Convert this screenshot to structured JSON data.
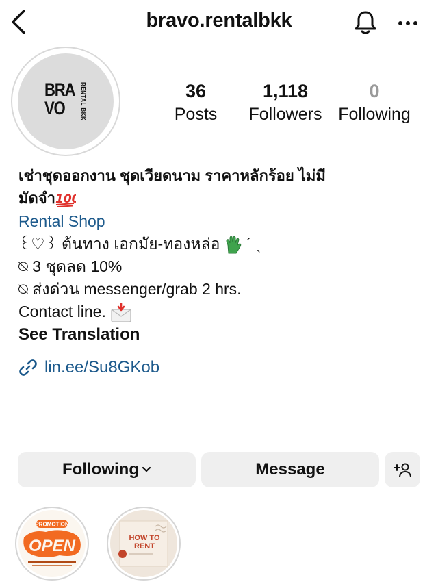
{
  "header": {
    "username": "bravo.rentalbkk",
    "back_icon": "chevron-left-icon",
    "bell_icon": "bell-icon",
    "more_icon": "more-horizontal-icon"
  },
  "profile": {
    "logo_text_line1": "BRA",
    "logo_text_line2": "VO",
    "logo_sub": "RENTAL BKK"
  },
  "stats": {
    "posts": {
      "value": "36",
      "label": "Posts"
    },
    "followers": {
      "value": "1,118",
      "label": "Followers"
    },
    "following": {
      "value": "0",
      "label": "Following"
    }
  },
  "bio": {
    "name_line1": "เช่าชุดออกงาน ชุดเวียดนาม ราคาหลักร้อย ไม่มี",
    "name_line2": "มัดจำ",
    "category": "Rental Shop",
    "line1": "꒰♡꒱ ต้นทาง เอกมัย-ทองหล่อ",
    "line1_tail": " ´ ˎ",
    "line2": "⍉ 3 ชุดลด 10%",
    "line3": "⍉ ส่งด่วน messenger/grab 2 hrs.",
    "line4": "Contact line.",
    "see_translation": "See Translation",
    "link": "lin.ee/Su8GKob"
  },
  "buttons": {
    "following": "Following",
    "message": "Message"
  },
  "highlights": {
    "h1_line1": "PROMOTION",
    "h1_line2": "OPEN",
    "h2_line1": "HOW TO",
    "h2_line2": "RENT"
  },
  "colors": {
    "link_blue": "#1d5a8c",
    "pill_bg": "#efefef",
    "promo_orange": "#f26a21"
  }
}
